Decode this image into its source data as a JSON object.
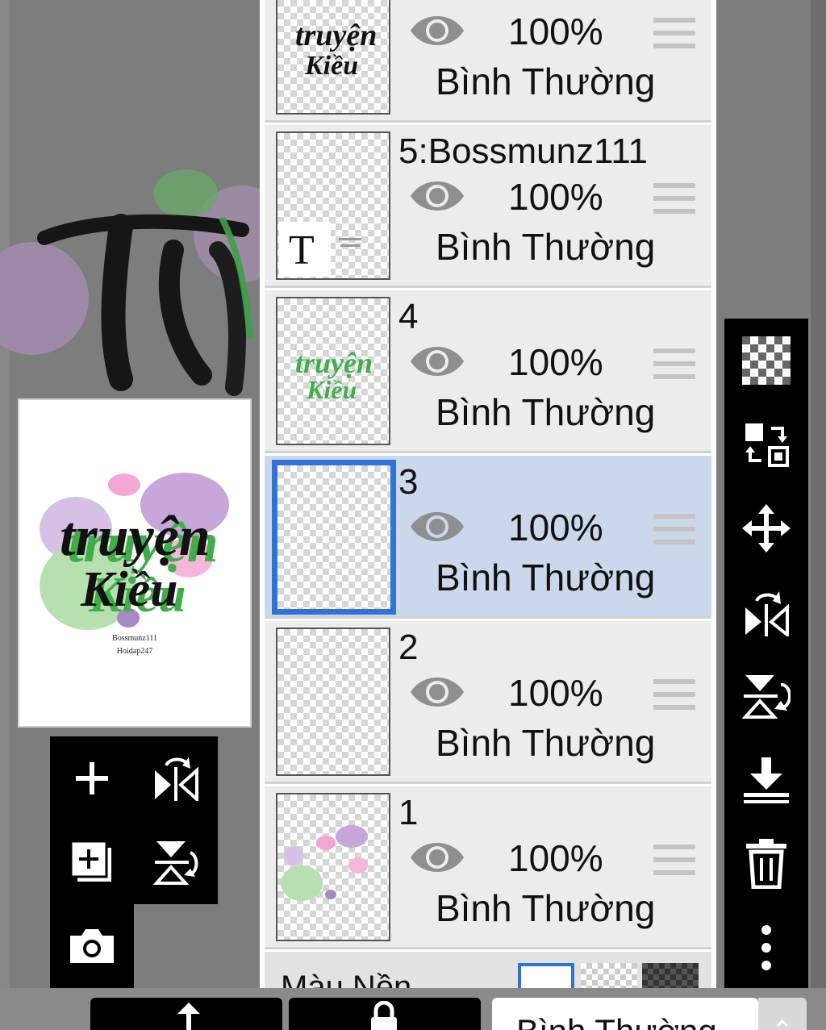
{
  "preview": {
    "title_line1": "truyện",
    "title_line2": "Kiều",
    "credit_line1": "Bossmunz111",
    "credit_line2": "Hoidap247"
  },
  "layers": [
    {
      "name": "",
      "opacity": "100%",
      "blend": "Bình Thường",
      "visible": true,
      "selected": false,
      "thumb": "script-text-black"
    },
    {
      "name": "5:Bossmunz111",
      "opacity": "100%",
      "blend": "Bình Thường",
      "visible": true,
      "selected": false,
      "thumb": "text-layer"
    },
    {
      "name": "4",
      "opacity": "100%",
      "blend": "Bình Thường",
      "visible": true,
      "selected": false,
      "thumb": "script-text-green"
    },
    {
      "name": "3",
      "opacity": "100%",
      "blend": "Bình Thường",
      "visible": true,
      "selected": true,
      "thumb": "empty"
    },
    {
      "name": "2",
      "opacity": "100%",
      "blend": "Bình Thường",
      "visible": true,
      "selected": false,
      "thumb": "empty"
    },
    {
      "name": "1",
      "opacity": "100%",
      "blend": "Bình Thường",
      "visible": true,
      "selected": false,
      "thumb": "blobs"
    }
  ],
  "thumbs": {
    "layer6_line1": "truyện",
    "layer6_line2": "Kiều",
    "layer4_line1": "truyện",
    "layer4_line2": "Kiều",
    "layer5_glyph": "T"
  },
  "background_row": {
    "label": "Màu Nền"
  },
  "bottom_bar": {
    "blend_mode": "Bình Thường"
  },
  "icons": {
    "left_tools": [
      "add-layer-icon",
      "flip-horizontal-icon",
      "copy-layer-icon",
      "flip-vertical-icon",
      "camera-icon"
    ],
    "right_tools": [
      "transparency-checker-icon",
      "swap-icon",
      "move-icon",
      "flip-horizontal-icon",
      "flip-vertical-icon",
      "merge-down-icon",
      "trash-icon",
      "more-options-icon"
    ]
  },
  "colors": {
    "selected_layer": "#cbd8ec",
    "selection_border": "#2f73d9",
    "green_text": "#3fae49",
    "purple_blob": "#c7a6da",
    "pink_blob": "#f3a6d2",
    "green_blob": "#b8dfb2"
  }
}
